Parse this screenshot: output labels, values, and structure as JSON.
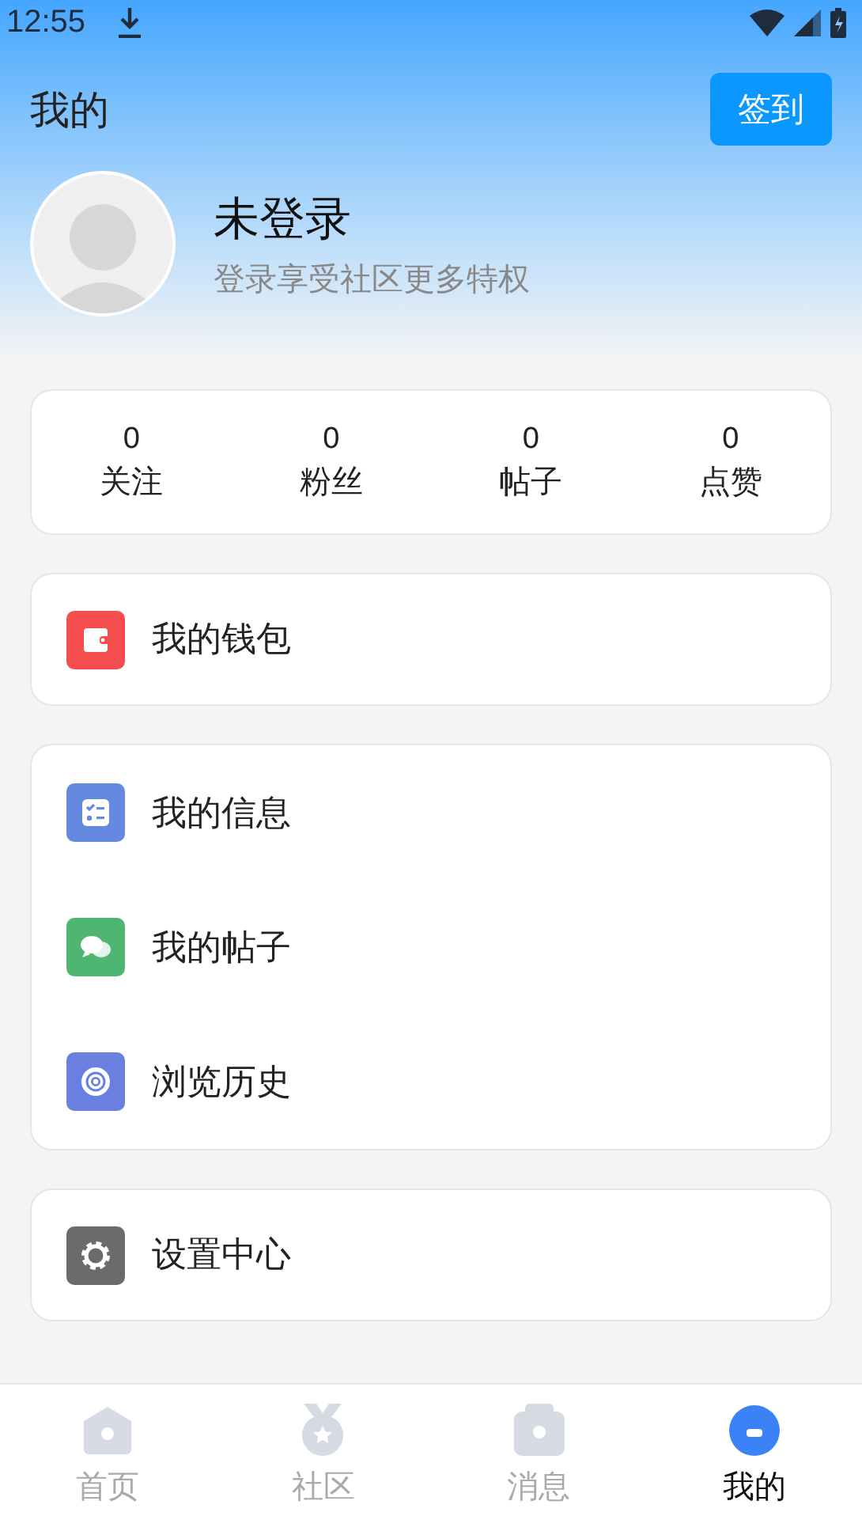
{
  "status_bar": {
    "time": "12:55"
  },
  "header": {
    "title": "我的",
    "checkin_button": "签到"
  },
  "profile": {
    "name": "未登录",
    "subtitle": "登录享受社区更多特权"
  },
  "stats": [
    {
      "value": "0",
      "label": "关注"
    },
    {
      "value": "0",
      "label": "粉丝"
    },
    {
      "value": "0",
      "label": "帖子"
    },
    {
      "value": "0",
      "label": "点赞"
    }
  ],
  "menu_groups": [
    [
      {
        "kind": "wallet",
        "label": "我的钱包",
        "color": "#f44e4e"
      }
    ],
    [
      {
        "kind": "info",
        "label": "我的信息",
        "color": "#6588e0"
      },
      {
        "kind": "posts",
        "label": "我的帖子",
        "color": "#4fb671"
      },
      {
        "kind": "history",
        "label": "浏览历史",
        "color": "#6a80e0"
      }
    ],
    [
      {
        "kind": "settings",
        "label": "设置中心",
        "color": "#6b6b6b"
      }
    ]
  ],
  "tab_bar": [
    {
      "kind": "home",
      "label": "首页",
      "selected": false
    },
    {
      "kind": "community",
      "label": "社区",
      "selected": false
    },
    {
      "kind": "messages",
      "label": "消息",
      "selected": false
    },
    {
      "kind": "me",
      "label": "我的",
      "selected": true
    }
  ]
}
